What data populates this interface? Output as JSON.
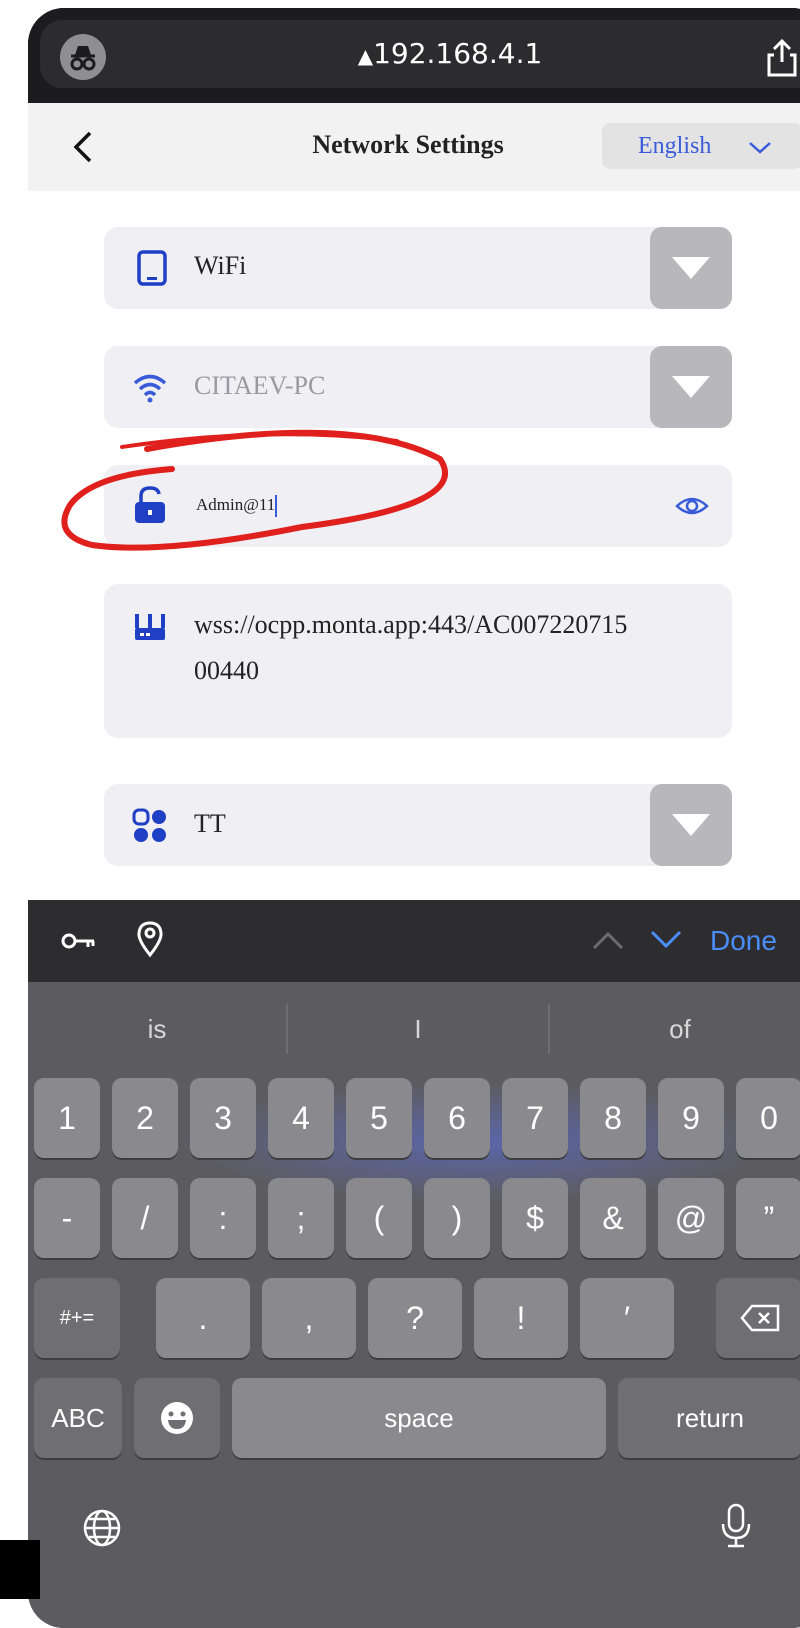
{
  "browser": {
    "url": "192.168.4.1"
  },
  "header": {
    "title": "Network Settings",
    "language": "English"
  },
  "form": {
    "connection_type": "WiFi",
    "ssid": "CITAEV-PC",
    "password": "Admin@11",
    "server_url_line1": "wss://ocpp.monta.app:443/AC007220715",
    "server_url_line2": "00440",
    "mode": "TT"
  },
  "accessory": {
    "done_label": "Done"
  },
  "keyboard": {
    "suggestions": [
      "is",
      "I",
      "of"
    ],
    "row1": [
      "1",
      "2",
      "3",
      "4",
      "5",
      "6",
      "7",
      "8",
      "9",
      "0"
    ],
    "row2": [
      "-",
      "/",
      ":",
      ";",
      "(",
      ")",
      "$",
      "&",
      "@",
      "”"
    ],
    "row3_toggle": "#+=",
    "row3": [
      ".",
      ",",
      "?",
      "!",
      "′"
    ],
    "abc": "ABC",
    "space": "space",
    "return": "return"
  },
  "colors": {
    "accent_blue": "#3a5bd9",
    "ios_blue": "#4a8df8",
    "annotation_red": "#e0201c"
  },
  "icons": [
    "incognito-icon",
    "share-icon",
    "back-chevron-icon",
    "chevron-down-icon",
    "tablet-icon",
    "wifi-icon",
    "lock-icon",
    "eye-icon",
    "router-icon",
    "grid-icon",
    "key-icon",
    "location-pin-icon",
    "chevron-up-icon",
    "globe-icon",
    "microphone-icon",
    "emoji-icon",
    "backspace-icon"
  ]
}
